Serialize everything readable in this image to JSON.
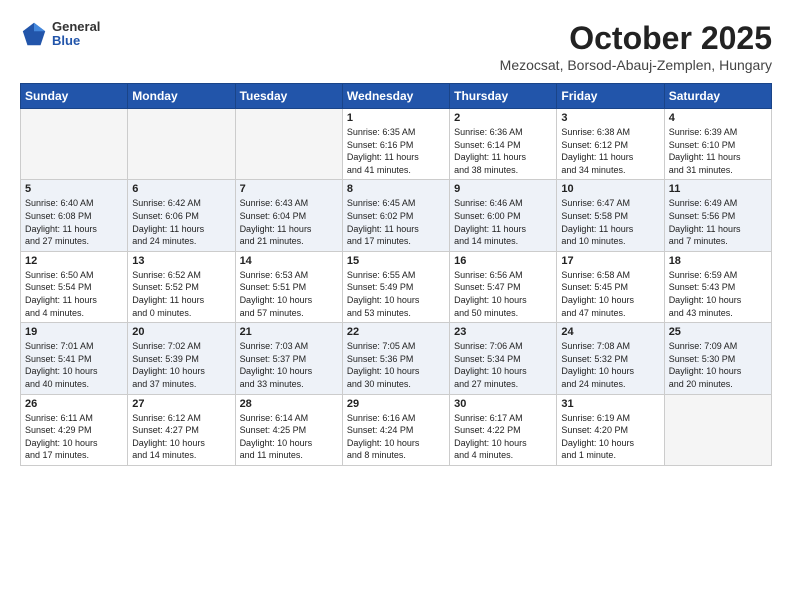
{
  "header": {
    "logo": {
      "general": "General",
      "blue": "Blue"
    },
    "month": "October 2025",
    "location": "Mezocsat, Borsod-Abauj-Zemplen, Hungary"
  },
  "weekdays": [
    "Sunday",
    "Monday",
    "Tuesday",
    "Wednesday",
    "Thursday",
    "Friday",
    "Saturday"
  ],
  "weeks": [
    [
      {
        "day": "",
        "info": ""
      },
      {
        "day": "",
        "info": ""
      },
      {
        "day": "",
        "info": ""
      },
      {
        "day": "1",
        "info": "Sunrise: 6:35 AM\nSunset: 6:16 PM\nDaylight: 11 hours\nand 41 minutes."
      },
      {
        "day": "2",
        "info": "Sunrise: 6:36 AM\nSunset: 6:14 PM\nDaylight: 11 hours\nand 38 minutes."
      },
      {
        "day": "3",
        "info": "Sunrise: 6:38 AM\nSunset: 6:12 PM\nDaylight: 11 hours\nand 34 minutes."
      },
      {
        "day": "4",
        "info": "Sunrise: 6:39 AM\nSunset: 6:10 PM\nDaylight: 11 hours\nand 31 minutes."
      }
    ],
    [
      {
        "day": "5",
        "info": "Sunrise: 6:40 AM\nSunset: 6:08 PM\nDaylight: 11 hours\nand 27 minutes."
      },
      {
        "day": "6",
        "info": "Sunrise: 6:42 AM\nSunset: 6:06 PM\nDaylight: 11 hours\nand 24 minutes."
      },
      {
        "day": "7",
        "info": "Sunrise: 6:43 AM\nSunset: 6:04 PM\nDaylight: 11 hours\nand 21 minutes."
      },
      {
        "day": "8",
        "info": "Sunrise: 6:45 AM\nSunset: 6:02 PM\nDaylight: 11 hours\nand 17 minutes."
      },
      {
        "day": "9",
        "info": "Sunrise: 6:46 AM\nSunset: 6:00 PM\nDaylight: 11 hours\nand 14 minutes."
      },
      {
        "day": "10",
        "info": "Sunrise: 6:47 AM\nSunset: 5:58 PM\nDaylight: 11 hours\nand 10 minutes."
      },
      {
        "day": "11",
        "info": "Sunrise: 6:49 AM\nSunset: 5:56 PM\nDaylight: 11 hours\nand 7 minutes."
      }
    ],
    [
      {
        "day": "12",
        "info": "Sunrise: 6:50 AM\nSunset: 5:54 PM\nDaylight: 11 hours\nand 4 minutes."
      },
      {
        "day": "13",
        "info": "Sunrise: 6:52 AM\nSunset: 5:52 PM\nDaylight: 11 hours\nand 0 minutes."
      },
      {
        "day": "14",
        "info": "Sunrise: 6:53 AM\nSunset: 5:51 PM\nDaylight: 10 hours\nand 57 minutes."
      },
      {
        "day": "15",
        "info": "Sunrise: 6:55 AM\nSunset: 5:49 PM\nDaylight: 10 hours\nand 53 minutes."
      },
      {
        "day": "16",
        "info": "Sunrise: 6:56 AM\nSunset: 5:47 PM\nDaylight: 10 hours\nand 50 minutes."
      },
      {
        "day": "17",
        "info": "Sunrise: 6:58 AM\nSunset: 5:45 PM\nDaylight: 10 hours\nand 47 minutes."
      },
      {
        "day": "18",
        "info": "Sunrise: 6:59 AM\nSunset: 5:43 PM\nDaylight: 10 hours\nand 43 minutes."
      }
    ],
    [
      {
        "day": "19",
        "info": "Sunrise: 7:01 AM\nSunset: 5:41 PM\nDaylight: 10 hours\nand 40 minutes."
      },
      {
        "day": "20",
        "info": "Sunrise: 7:02 AM\nSunset: 5:39 PM\nDaylight: 10 hours\nand 37 minutes."
      },
      {
        "day": "21",
        "info": "Sunrise: 7:03 AM\nSunset: 5:37 PM\nDaylight: 10 hours\nand 33 minutes."
      },
      {
        "day": "22",
        "info": "Sunrise: 7:05 AM\nSunset: 5:36 PM\nDaylight: 10 hours\nand 30 minutes."
      },
      {
        "day": "23",
        "info": "Sunrise: 7:06 AM\nSunset: 5:34 PM\nDaylight: 10 hours\nand 27 minutes."
      },
      {
        "day": "24",
        "info": "Sunrise: 7:08 AM\nSunset: 5:32 PM\nDaylight: 10 hours\nand 24 minutes."
      },
      {
        "day": "25",
        "info": "Sunrise: 7:09 AM\nSunset: 5:30 PM\nDaylight: 10 hours\nand 20 minutes."
      }
    ],
    [
      {
        "day": "26",
        "info": "Sunrise: 6:11 AM\nSunset: 4:29 PM\nDaylight: 10 hours\nand 17 minutes."
      },
      {
        "day": "27",
        "info": "Sunrise: 6:12 AM\nSunset: 4:27 PM\nDaylight: 10 hours\nand 14 minutes."
      },
      {
        "day": "28",
        "info": "Sunrise: 6:14 AM\nSunset: 4:25 PM\nDaylight: 10 hours\nand 11 minutes."
      },
      {
        "day": "29",
        "info": "Sunrise: 6:16 AM\nSunset: 4:24 PM\nDaylight: 10 hours\nand 8 minutes."
      },
      {
        "day": "30",
        "info": "Sunrise: 6:17 AM\nSunset: 4:22 PM\nDaylight: 10 hours\nand 4 minutes."
      },
      {
        "day": "31",
        "info": "Sunrise: 6:19 AM\nSunset: 4:20 PM\nDaylight: 10 hours\nand 1 minute."
      },
      {
        "day": "",
        "info": ""
      }
    ]
  ]
}
